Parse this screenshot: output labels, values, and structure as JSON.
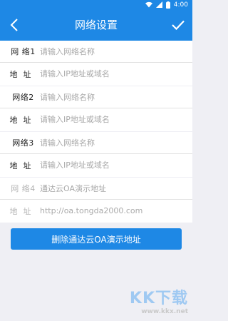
{
  "status_bar": {
    "time": "4:00"
  },
  "toolbar": {
    "title": "网络设置"
  },
  "groups": [
    {
      "name_label": "网 络1",
      "name_placeholder": "请输入网络名称",
      "addr_label": "地址",
      "addr_placeholder": "请输入IP地址或域名"
    },
    {
      "name_label": "网络2",
      "name_placeholder": "请输入网络名称",
      "addr_label": "地址",
      "addr_placeholder": "请输入IP地址或域名"
    },
    {
      "name_label": "网络3",
      "name_placeholder": "请输入网络名称",
      "addr_label": "地址",
      "addr_placeholder": "请输入IP地址或域名"
    },
    {
      "name_label": "网 络4",
      "name_value": "通达云OA演示地址",
      "addr_label": "地址",
      "addr_value": "http://oa.tongda2000.com"
    }
  ],
  "actions": {
    "delete_demo_label": "删除通达云OA演示地址"
  },
  "watermark": {
    "brand": "KK下载",
    "url": "www.kkx.net"
  },
  "colors": {
    "primary": "#1e88e5",
    "background": "#efeff4"
  }
}
